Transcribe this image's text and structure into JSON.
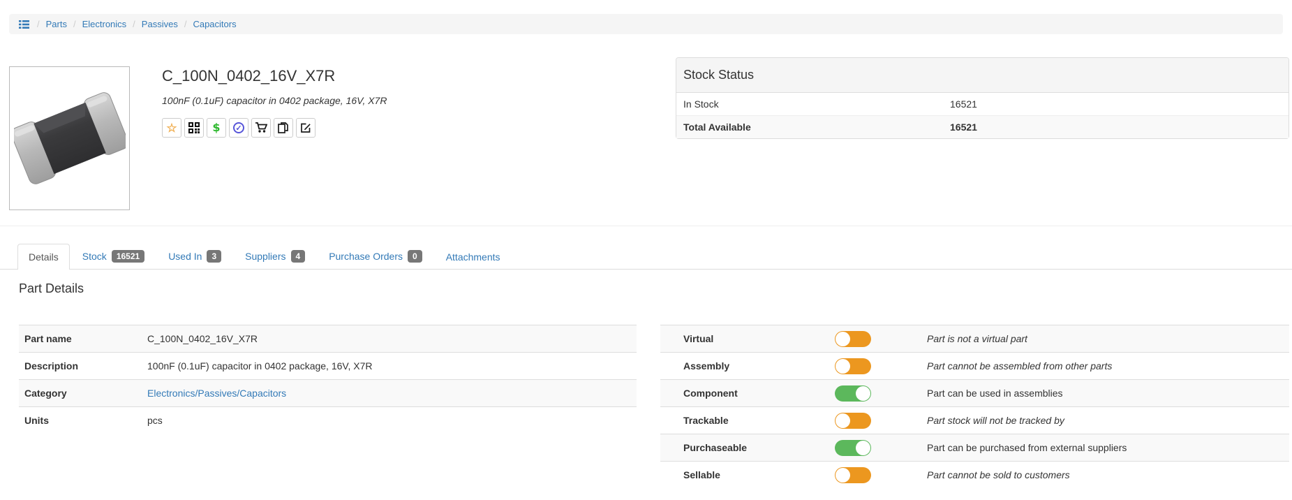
{
  "breadcrumb": {
    "icon": "list-icon",
    "separator": "/",
    "items": [
      {
        "label": "Parts"
      },
      {
        "label": "Electronics"
      },
      {
        "label": "Passives"
      },
      {
        "label": "Capacitors"
      }
    ]
  },
  "part": {
    "name": "C_100N_0402_16V_X7R",
    "description": "100nF (0.1uF) capacitor in 0402 package, 16V, X7R",
    "image_alt": "chip capacitor photo",
    "actions": [
      {
        "icon": "star-icon"
      },
      {
        "icon": "qrcode-icon"
      },
      {
        "icon": "price-dollar-icon"
      },
      {
        "icon": "validate-check-icon"
      },
      {
        "icon": "order-cart-icon"
      },
      {
        "icon": "duplicate-copy-icon"
      },
      {
        "icon": "edit-icon"
      }
    ]
  },
  "stock_status": {
    "title": "Stock Status",
    "rows": [
      {
        "label": "In Stock",
        "value": "16521"
      },
      {
        "label": "Total Available",
        "value": "16521"
      }
    ]
  },
  "tabs": [
    {
      "label": "Details",
      "badge": "",
      "active": true
    },
    {
      "label": "Stock",
      "badge": "16521",
      "active": false
    },
    {
      "label": "Used In",
      "badge": "3",
      "active": false
    },
    {
      "label": "Suppliers",
      "badge": "4",
      "active": false
    },
    {
      "label": "Purchase Orders",
      "badge": "0",
      "active": false
    },
    {
      "label": "Attachments",
      "badge": "",
      "active": false
    }
  ],
  "part_details": {
    "heading": "Part Details",
    "left_rows": [
      {
        "label": "Part name",
        "value": "C_100N_0402_16V_X7R"
      },
      {
        "label": "Description",
        "value": "100nF (0.1uF) capacitor in 0402 package, 16V, X7R"
      },
      {
        "label": "Category",
        "value": "Electronics/Passives/Capacitors"
      },
      {
        "label": "Units",
        "value": "pcs"
      }
    ],
    "right_rows": [
      {
        "label": "Virtual",
        "on": false,
        "description": "Part is not a virtual part"
      },
      {
        "label": "Assembly",
        "on": false,
        "description": "Part cannot be assembled from other parts"
      },
      {
        "label": "Component",
        "on": true,
        "description": "Part can be used in assemblies"
      },
      {
        "label": "Trackable",
        "on": false,
        "description": "Part stock will not be tracked by"
      },
      {
        "label": "Purchaseable",
        "on": true,
        "description": "Part can be purchased from external suppliers"
      },
      {
        "label": "Sellable",
        "on": false,
        "description": "Part cannot be sold to customers"
      }
    ]
  },
  "colors": {
    "link": "#337ab7",
    "badge_bg": "#777777",
    "toggle_on": "#5cb85c",
    "toggle_off": "#ec971f",
    "star": "#f0ad4e",
    "dollar": "#2eb82e",
    "check_circle": "#5755d9",
    "panel_heading_bg": "#f5f5f5",
    "stripe": "#f9f9f9"
  }
}
